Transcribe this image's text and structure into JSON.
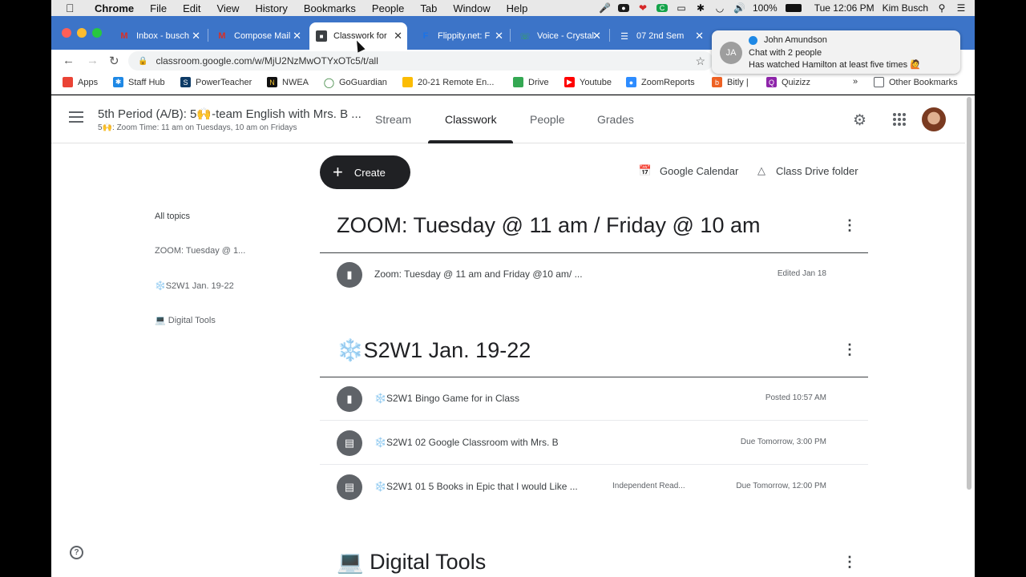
{
  "menubar": {
    "app_name": "Chrome",
    "items": [
      "File",
      "Edit",
      "View",
      "History",
      "Bookmarks",
      "People",
      "Tab",
      "Window",
      "Help"
    ],
    "battery": "100%",
    "clock": "Tue 12:06 PM",
    "user": "Kim Busch"
  },
  "tabs": [
    {
      "title": "Inbox - busch",
      "favicon": "gmail-icon",
      "color": "#d93025"
    },
    {
      "title": "Compose Mail",
      "favicon": "gmail-icon",
      "color": "#d93025"
    },
    {
      "title": "Classwork for",
      "favicon": "classroom-icon",
      "color": "#3c4043",
      "active": true
    },
    {
      "title": "Flippity.net: F",
      "favicon": "flippity-icon",
      "color": "#1a73e8"
    },
    {
      "title": "Voice - Crystal",
      "favicon": "voice-icon",
      "color": "#34a853"
    },
    {
      "title": "07 2nd Sem",
      "favicon": "docs-icon",
      "color": "#4285f4"
    }
  ],
  "address": {
    "url": "classroom.google.com/w/MjU2NzMwOTYxOTc5/t/all"
  },
  "bookmarks": [
    {
      "label": "Apps",
      "color": "#ea4335"
    },
    {
      "label": "Staff Hub",
      "color": "#1e88e5"
    },
    {
      "label": "PowerTeacher",
      "color": "#0d3b66"
    },
    {
      "label": "NWEA",
      "color": "#111111"
    },
    {
      "label": "GoGuardian",
      "color": "#2e7d32"
    },
    {
      "label": "20-21 Remote En...",
      "color": "#fbbc04"
    },
    {
      "label": "Drive",
      "color": "#34a853"
    },
    {
      "label": "Youtube",
      "color": "#ff0000"
    },
    {
      "label": "ZoomReports",
      "color": "#2d8cff"
    },
    {
      "label": "Bitly |",
      "color": "#ee6123"
    },
    {
      "label": "Quizizz",
      "color": "#8e24aa"
    }
  ],
  "bookmarks_more": "»",
  "other_bookmarks": "Other Bookmarks",
  "notification": {
    "avatar_initials": "JA",
    "name": "John Amundson",
    "subtitle": "Chat with 2 people",
    "message": "Has watched Hamilton at least five times 🙋"
  },
  "classroom": {
    "class_name": "5th Period (A/B): 5🙌-team English with Mrs. B ...",
    "class_sub": "5🙌: Zoom Time: 11 am on Tuesdays, 10 am on Fridays",
    "tabs": [
      "Stream",
      "Classwork",
      "People",
      "Grades"
    ],
    "active_tab": "Classwork",
    "create_label": "Create",
    "calendar_label": "Google Calendar",
    "drive_label": "Class Drive folder",
    "topics": [
      "All topics",
      "ZOOM: Tuesday @ 1...",
      "❄️S2W1 Jan. 19-22",
      "💻 Digital Tools"
    ],
    "sections": [
      {
        "title": "ZOOM: Tuesday @ 11 am / Friday @ 10 am",
        "items": [
          {
            "title": "Zoom: Tuesday @ 11 am and Friday @10 am/ ...",
            "meta": "Edited Jan 18",
            "icon": "material-icon"
          }
        ]
      },
      {
        "title": "❄️S2W1 Jan. 19-22",
        "items": [
          {
            "title": "❄️S2W1 Bingo Game for in Class",
            "meta": "Posted 10:57 AM",
            "icon": "material-icon"
          },
          {
            "title": "❄️S2W1 02 Google Classroom with Mrs. B",
            "meta": "Due Tomorrow, 3:00 PM",
            "icon": "assignment-icon"
          },
          {
            "title": "❄️S2W1 01 5 Books in Epic that I would Like ...",
            "category": "Independent Read...",
            "meta": "Due Tomorrow, 12:00 PM",
            "icon": "assignment-icon"
          }
        ]
      },
      {
        "title": "💻 Digital Tools",
        "items": []
      }
    ]
  },
  "help_label": "?"
}
